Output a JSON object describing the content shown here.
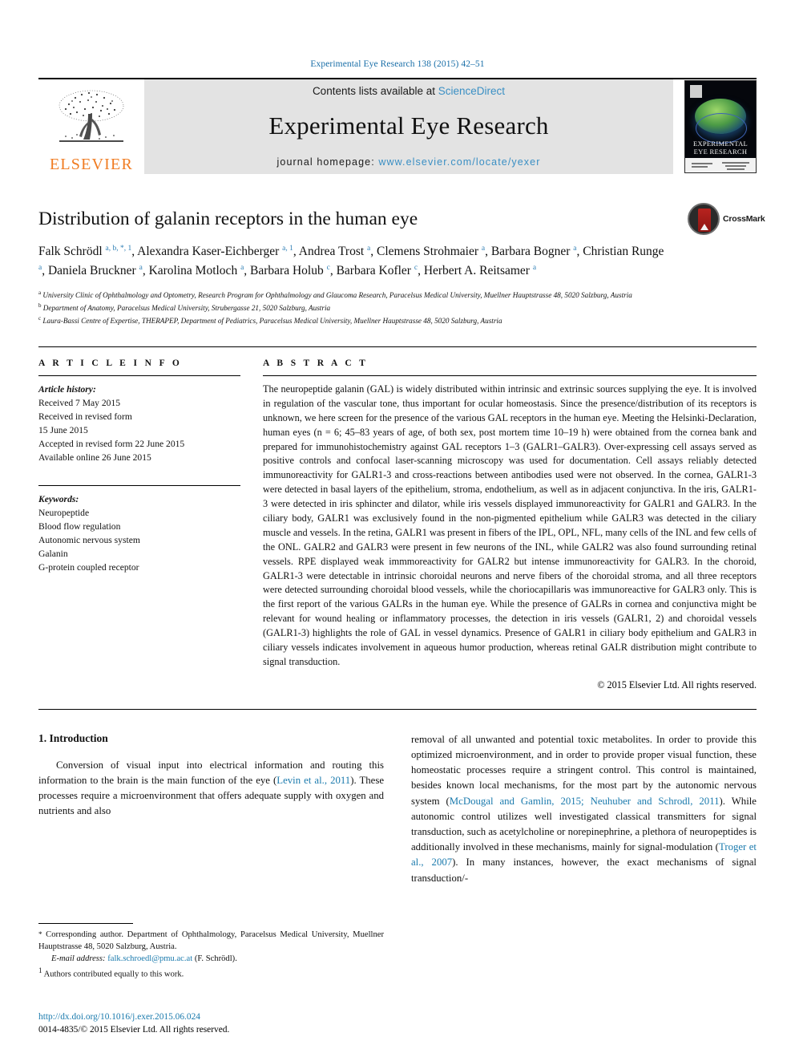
{
  "running_head": "Experimental Eye Research 138 (2015) 42–51",
  "masthead": {
    "contents_prefix": "Contents lists available at ",
    "sciencedirect": "ScienceDirect",
    "journal_name": "Experimental Eye Research",
    "homepage_prefix": "journal homepage: ",
    "homepage_url": "www.elsevier.com/locate/yexer",
    "publisher_logo_text": "ELSEVIER",
    "cover_title_line1": "EXPERIMENTAL",
    "cover_title_line2": "EYE RESEARCH",
    "accent_link_color": "#3a8fc4",
    "elsevier_orange": "#f07c22"
  },
  "article": {
    "title": "Distribution of galanin receptors in the human eye",
    "crossmark_label": "CrossMark",
    "authors_html": "Falk Schrödl <sup>a, b, *, 1</sup>, Alexandra Kaser-Eichberger <sup>a, 1</sup>, Andrea Trost <sup>a</sup>, Clemens Strohmaier <sup>a</sup>, Barbara Bogner <sup>a</sup>, Christian Runge <sup>a</sup>, Daniela Bruckner <sup>a</sup>, Karolina Motloch <sup>a</sup>, Barbara Holub <sup>c</sup>, Barbara Kofler <sup>c</sup>, Herbert A. Reitsamer <sup>a</sup>",
    "affiliations": [
      "<sup>a</sup> University Clinic of Ophthalmology and Optometry, Research Program for Ophthalmology and Glaucoma Research, Paracelsus Medical University, Muellner Hauptstrasse 48, 5020 Salzburg, Austria",
      "<sup>b</sup> Department of Anatomy, Paracelsus Medical University, Strubergasse 21, 5020 Salzburg, Austria",
      "<sup>c</sup> Laura-Bassi Centre of Expertise, THERAPEP, Department of Pediatrics, Paracelsus Medical University, Muellner Hauptstrasse 48, 5020 Salzburg, Austria"
    ]
  },
  "article_info": {
    "heading": "A R T I C L E  I N F O",
    "history_label": "Article history:",
    "history_lines": [
      "Received 7 May 2015",
      "Received in revised form",
      "15 June 2015",
      "Accepted in revised form 22 June 2015",
      "Available online 26 June 2015"
    ],
    "keywords_label": "Keywords:",
    "keywords": [
      "Neuropeptide",
      "Blood flow regulation",
      "Autonomic nervous system",
      "Galanin",
      "G-protein coupled receptor"
    ]
  },
  "abstract": {
    "heading": "A B S T R A C T",
    "text": "The neuropeptide galanin (GAL) is widely distributed within intrinsic and extrinsic sources supplying the eye. It is involved in regulation of the vascular tone, thus important for ocular homeostasis. Since the presence/distribution of its receptors is unknown, we here screen for the presence of the various GAL receptors in the human eye. Meeting the Helsinki-Declaration, human eyes (n = 6; 45–83 years of age, of both sex, post mortem time 10–19 h) were obtained from the cornea bank and prepared for immunohistochemistry against GAL receptors 1–3 (GALR1–GALR3). Over-expressing cell assays served as positive controls and confocal laser-scanning microscopy was used for documentation. Cell assays reliably detected immunoreactivity for GALR1-3 and cross-reactions between antibodies used were not observed. In the cornea, GALR1-3 were detected in basal layers of the epithelium, stroma, endothelium, as well as in adjacent conjunctiva. In the iris, GALR1-3 were detected in iris sphincter and dilator, while iris vessels displayed immunoreactivity for GALR1 and GALR3. In the ciliary body, GALR1 was exclusively found in the non-pigmented epithelium while GALR3 was detected in the ciliary muscle and vessels. In the retina, GALR1 was present in fibers of the IPL, OPL, NFL, many cells of the INL and few cells of the ONL. GALR2 and GALR3 were present in few neurons of the INL, while GALR2 was also found surrounding retinal vessels. RPE displayed weak immmoreactivity for GALR2 but intense immunoreactivity for GALR3. In the choroid, GALR1-3 were detectable in intrinsic choroidal neurons and nerve fibers of the choroidal stroma, and all three receptors were detected surrounding choroidal blood vessels, while the choriocapillaris was immunoreactive for GALR3 only. This is the first report of the various GALRs in the human eye. While the presence of GALRs in cornea and conjunctiva might be relevant for wound healing or inflammatory processes, the detection in iris vessels (GALR1, 2) and choroidal vessels (GALR1-3) highlights the role of GAL in vessel dynamics. Presence of GALR1 in ciliary body epithelium and GALR3 in ciliary vessels indicates involvement in aqueous humor production, whereas retinal GALR distribution might contribute to signal transduction.",
    "copyright": "© 2015 Elsevier Ltd. All rights reserved."
  },
  "introduction": {
    "heading": "1. Introduction",
    "left_paragraph_html": "Conversion of visual input into electrical information and routing this information to the brain is the main function of the eye (<span class=\"cite\">Levin et al., 2011</span>). These processes require a microenvironment that offers adequate supply with oxygen and nutrients and also",
    "right_paragraph_html": "removal of all unwanted and potential toxic metabolites. In order to provide this optimized microenvironment, and in order to provide proper visual function, these homeostatic processes require a stringent control. This control is maintained, besides known local mechanisms, for the most part by the autonomic nervous system (<span class=\"cite\">McDougal and Gamlin, 2015; Neuhuber and Schrodl, 2011</span>). While autonomic control utilizes well investigated classical transmitters for signal transduction, such as acetylcholine or norepinephrine, a plethora of neuropeptides is additionally involved in these mechanisms, mainly for signal-modulation (<span class=\"cite\">Troger et al., 2007</span>). In many instances, however, the exact mechanisms of signal transduction/-"
  },
  "footnotes": {
    "corresponding_html": "<span class=\"star\">*</span> Corresponding author. Department of Ophthalmology, Paracelsus Medical University, Muellner Hauptstrasse 48, 5020 Salzburg, Austria.",
    "email_label": "E-mail address:",
    "email": "falk.schroedl@pmu.ac.at",
    "email_owner": "(F. Schrödl).",
    "equal_contrib_html": "<sup>1</sup> Authors contributed equally to this work."
  },
  "footer": {
    "doi": "http://dx.doi.org/10.1016/j.exer.2015.06.024",
    "issn_line": "0014-4835/© 2015 Elsevier Ltd. All rights reserved."
  }
}
